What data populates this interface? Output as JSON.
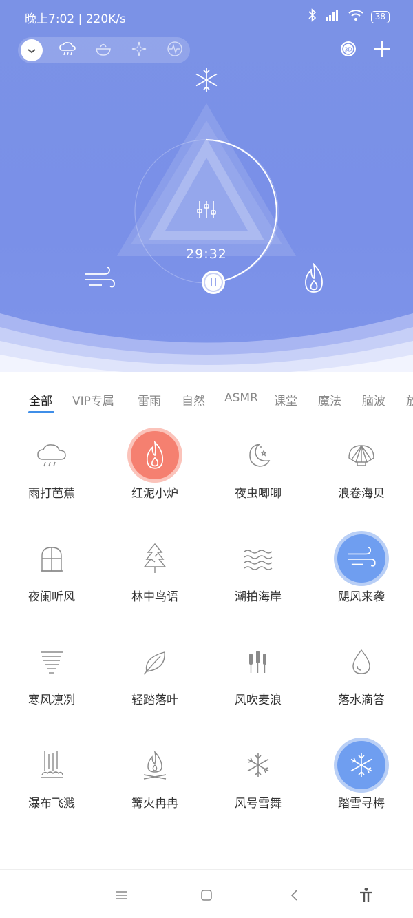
{
  "status_bar": {
    "time": "晚上7:02 | 220K/s",
    "battery": "38"
  },
  "scene_chips": [
    {
      "icon": "chevron-down-icon",
      "active": true
    },
    {
      "icon": "rain-cloud-icon"
    },
    {
      "icon": "bowl-icon"
    },
    {
      "icon": "sparkle-icon"
    },
    {
      "icon": "brainwave-icon"
    }
  ],
  "player": {
    "timer": "29:32",
    "state": "playing"
  },
  "tabs": [
    "全部",
    "VIP专属",
    "雷雨",
    "自然",
    "ASMR",
    "课堂",
    "魔法",
    "脑波",
    "放"
  ],
  "active_tab": "全部",
  "sounds": [
    {
      "label": "雨打芭蕉",
      "icon": "rain-cloud-icon"
    },
    {
      "label": "红泥小炉",
      "icon": "flame-icon",
      "active": true,
      "active_color": "#f58070"
    },
    {
      "label": "夜虫唧唧",
      "icon": "moon-star-icon"
    },
    {
      "label": "浪卷海贝",
      "icon": "shell-icon"
    },
    {
      "label": "夜阑听风",
      "icon": "window-icon"
    },
    {
      "label": "林中鸟语",
      "icon": "tree-icon"
    },
    {
      "label": "潮拍海岸",
      "icon": "waves-icon"
    },
    {
      "label": "飓风来袭",
      "icon": "wind-icon",
      "active": true,
      "active_color": "#6f9ef0"
    },
    {
      "label": "寒风凛冽",
      "icon": "cold-wind-icon"
    },
    {
      "label": "轻踏落叶",
      "icon": "leaf-icon"
    },
    {
      "label": "风吹麦浪",
      "icon": "wheat-icon"
    },
    {
      "label": "落水滴答",
      "icon": "droplet-icon"
    },
    {
      "label": "瀑布飞溅",
      "icon": "waterfall-icon"
    },
    {
      "label": "篝火冉冉",
      "icon": "campfire-icon"
    },
    {
      "label": "风号雪舞",
      "icon": "snowflake-icon"
    },
    {
      "label": "踏雪寻梅",
      "icon": "snowflake-icon",
      "active": true,
      "active_color": "#6f9ef0"
    }
  ],
  "colors": {
    "hero": "#7b92e6",
    "tab_accent": "#3f8ee8",
    "icon_stroke": "#8a8a8a"
  }
}
